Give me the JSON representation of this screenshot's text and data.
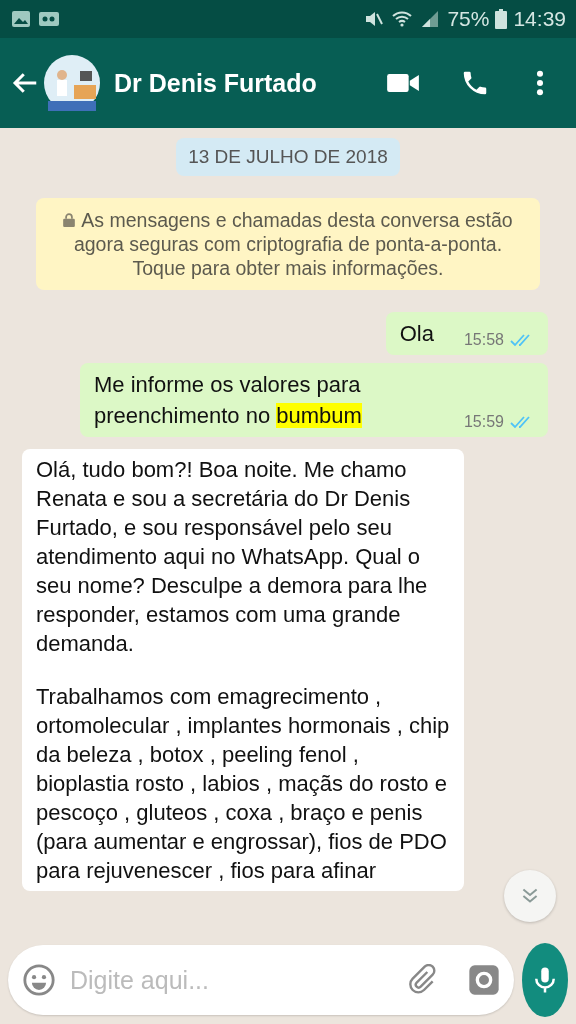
{
  "status_bar": {
    "battery": "75%",
    "time": "14:39"
  },
  "header": {
    "contact_name": "Dr Denis Furtado"
  },
  "date_chip": "13 DE JULHO DE 2018",
  "encryption_notice": "As mensagens e chamadas desta conversa estão agora seguras com criptografia de ponta-a-ponta. Toque para obter mais informações.",
  "messages": [
    {
      "kind": "outgoing",
      "text": "Ola",
      "time": "15:58",
      "read": true
    },
    {
      "kind": "outgoing",
      "text": "Me informe os valores para preenchimento no",
      "highlight": "bumbum",
      "time": "15:59",
      "read": true
    },
    {
      "kind": "incoming",
      "paragraphs": [
        "Olá, tudo bom?! Boa noite. Me chamo Renata e sou a secretária do Dr Denis Furtado, e sou responsável pelo seu atendimento aqui no WhatsApp. Qual o seu nome? Desculpe a demora para lhe responder, estamos com uma grande demanda.",
        "Trabalhamos com emagrecimento , ortomolecular , implantes hormonais , chip da beleza , botox , peeling fenol , bioplastia rosto ,  labios , maçãs do rosto e pescoço , gluteos , coxa , braço e  penis (para aumentar e engrossar), fios de PDO para rejuvenescer , fios para afinar"
      ]
    }
  ],
  "composer": {
    "placeholder": "Digite aqui..."
  }
}
